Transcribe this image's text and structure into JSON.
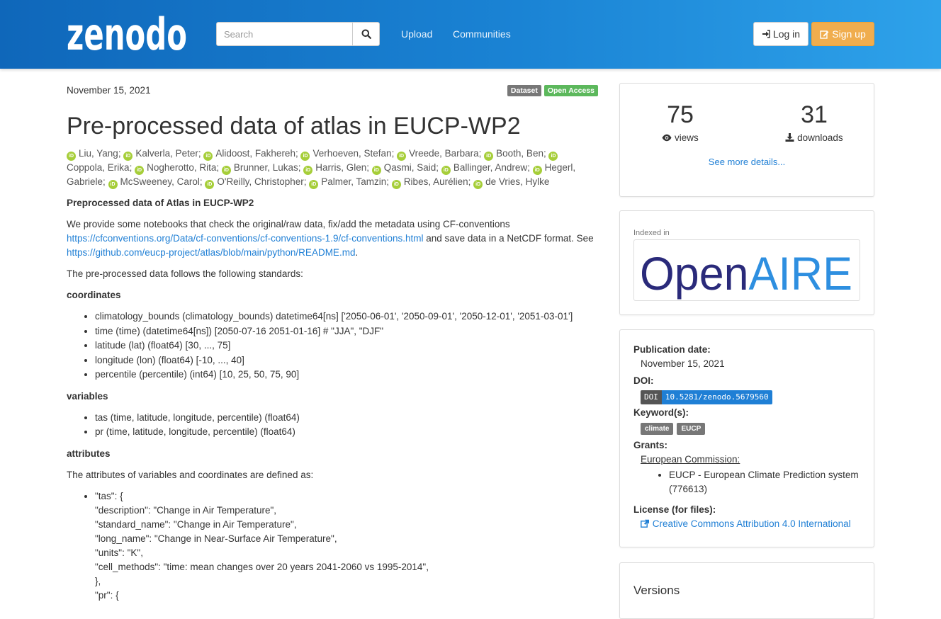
{
  "nav": {
    "search_placeholder": "Search",
    "links": [
      "Upload",
      "Communities"
    ],
    "login": "Log in",
    "signup": "Sign up"
  },
  "record": {
    "date": "November 15, 2021",
    "badges": [
      "Dataset",
      "Open Access"
    ],
    "title": "Pre-processed data of atlas in EUCP-WP2",
    "authors": [
      "Liu, Yang",
      "Kalverla, Peter",
      "Alidoost, Fakhereh",
      "Verhoeven, Stefan",
      "Vreede, Barbara",
      "Booth, Ben",
      "Coppola, Erika",
      "Nogherotto, Rita",
      "Brunner, Lukas",
      "Harris, Glen",
      "Qasmi, Said",
      "Ballinger, Andrew",
      "Hegerl, Gabriele",
      "McSweeney, Carol",
      "O'Reilly, Christopher",
      "Palmer, Tamzin",
      "Ribes, Aurélien",
      "de Vries, Hylke"
    ]
  },
  "description": {
    "heading": "Preprocessed data of Atlas in EUCP-WP2",
    "p1_a": "We provide some notebooks that check the original/raw data, fix/add the metadata using CF-conventions",
    "p1_link1": "https://cfconventions.org/Data/cf-conventions/cf-conventions-1.9/cf-conventions.html",
    "p1_b": "and save data in a NetCDF format. See",
    "p1_link2": "https://github.com/eucp-project/atlas/blob/main/python/README.md",
    "p1_c": ".",
    "p2": "The pre-processed data follows the following standards:",
    "coords_heading": "coordinates",
    "coords": [
      "climatology_bounds (climatology_bounds) datetime64[ns] ['2050-06-01', '2050-09-01', '2050-12-01', '2051-03-01']",
      "time (time) (datetime64[ns]) [2050-07-16 2051-01-16] # \"JJA\", \"DJF\"",
      "latitude (lat) (float64) [30, ..., 75]",
      "longitude (lon) (float64) [-10, ..., 40]",
      "percentile (percentile) (int64) [10, 25, 50, 75, 90]"
    ],
    "vars_heading": "variables",
    "vars": [
      "tas (time, latitude, longitude, percentile) (float64)",
      "pr (time, latitude, longitude, percentile) (float64)"
    ],
    "attrs_heading": "attributes",
    "attrs_intro": "The attributes of variables and coordinates are defined as:",
    "attrs_tas": "\"tas\": {",
    "attrs_lines": [
      "\"description\": \"Change in Air Temperature\",",
      "\"standard_name\": \"Change in Air Temperature\",",
      "\"long_name\": \"Change in Near-Surface Air Temperature\",",
      "\"units\": \"K\",",
      "\"cell_methods\": \"time: mean changes over 20 years 2041-2060 vs 1995-2014\",",
      "},"
    ],
    "attrs_pr": "\"pr\": {"
  },
  "stats": {
    "views": "75",
    "views_label": "views",
    "downloads": "31",
    "downloads_label": "downloads",
    "more": "See more details..."
  },
  "indexed": {
    "label": "Indexed in",
    "logo_text": "OpenAIRE"
  },
  "meta": {
    "pub_date_label": "Publication date:",
    "pub_date": "November 15, 2021",
    "doi_label": "DOI:",
    "doi_prefix": "DOI",
    "doi": "10.5281/zenodo.5679560",
    "keywords_label": "Keyword(s):",
    "keywords": [
      "climate",
      "EUCP"
    ],
    "grants_label": "Grants:",
    "funder": "European Commission:",
    "grant": "EUCP - European Climate Prediction system (776613)",
    "license_label": "License (for files):",
    "license": "Creative Commons Attribution 4.0 International"
  },
  "versions": {
    "title": "Versions"
  },
  "colors": {
    "navbar": "#1a83d4",
    "signup": "#f0ad4e",
    "open_access": "#5cb85c",
    "link": "#1f7fd5",
    "orcid": "#a6ce39"
  }
}
